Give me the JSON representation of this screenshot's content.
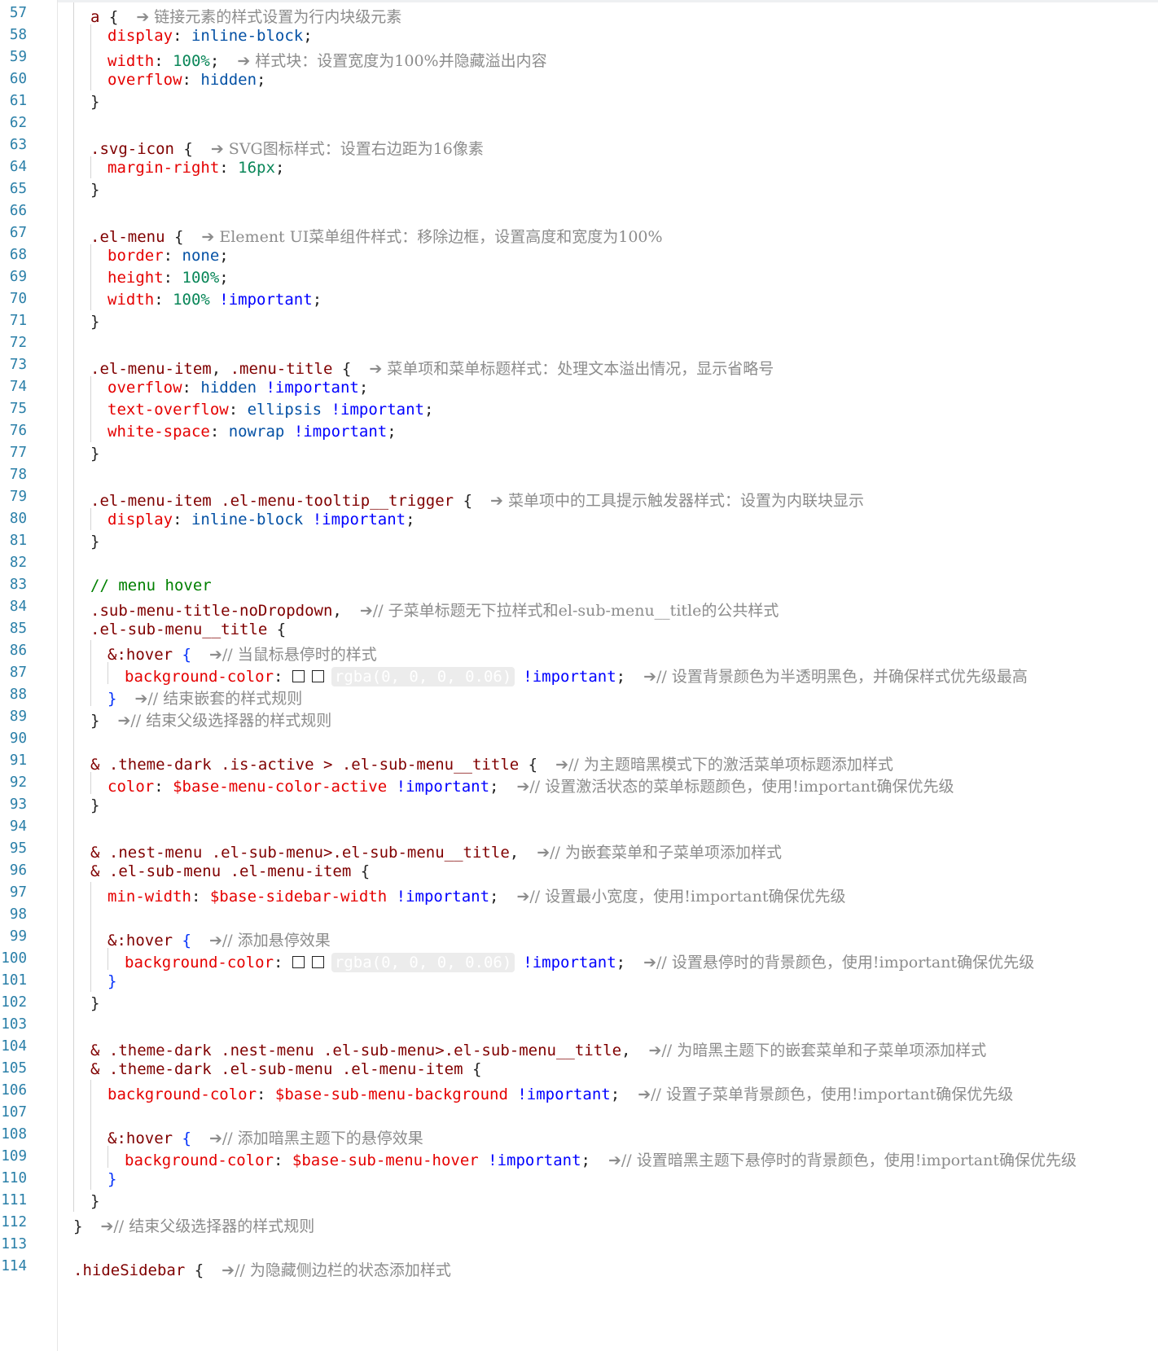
{
  "editor": {
    "lines": [
      {
        "n": "57",
        "indent": 2,
        "tokens": [
          {
            "c": "sel",
            "t": "a "
          },
          {
            "c": "pun",
            "t": "{"
          }
        ],
        "ann": "➔ 链接元素的样式设置为行内块级元素"
      },
      {
        "n": "58",
        "indent": 3,
        "tokens": [
          {
            "c": "prop",
            "t": "display"
          },
          {
            "c": "pun",
            "t": ": "
          },
          {
            "c": "val",
            "t": "inline-block"
          },
          {
            "c": "pun",
            "t": ";"
          }
        ]
      },
      {
        "n": "59",
        "indent": 3,
        "tokens": [
          {
            "c": "prop",
            "t": "width"
          },
          {
            "c": "pun",
            "t": ": "
          },
          {
            "c": "num",
            "t": "100%"
          },
          {
            "c": "pun",
            "t": ";"
          }
        ],
        "ann": "➔ 样式块：设置宽度为100%并隐藏溢出内容"
      },
      {
        "n": "60",
        "indent": 3,
        "tokens": [
          {
            "c": "prop",
            "t": "overflow"
          },
          {
            "c": "pun",
            "t": ": "
          },
          {
            "c": "val",
            "t": "hidden"
          },
          {
            "c": "pun",
            "t": ";"
          }
        ]
      },
      {
        "n": "61",
        "indent": 2,
        "tokens": [
          {
            "c": "pun",
            "t": "}"
          }
        ]
      },
      {
        "n": "62",
        "indent": 0,
        "tokens": []
      },
      {
        "n": "63",
        "indent": 2,
        "tokens": [
          {
            "c": "sel",
            "t": ".svg-icon "
          },
          {
            "c": "pun",
            "t": "{"
          }
        ],
        "ann": "➔ SVG图标样式：设置右边距为16像素"
      },
      {
        "n": "64",
        "indent": 3,
        "tokens": [
          {
            "c": "prop",
            "t": "margin-right"
          },
          {
            "c": "pun",
            "t": ": "
          },
          {
            "c": "num",
            "t": "16px"
          },
          {
            "c": "pun",
            "t": ";"
          }
        ]
      },
      {
        "n": "65",
        "indent": 2,
        "tokens": [
          {
            "c": "pun",
            "t": "}"
          }
        ]
      },
      {
        "n": "66",
        "indent": 0,
        "tokens": []
      },
      {
        "n": "67",
        "indent": 2,
        "tokens": [
          {
            "c": "sel",
            "t": ".el-menu "
          },
          {
            "c": "pun",
            "t": "{"
          }
        ],
        "ann": "➔ Element UI菜单组件样式：移除边框，设置高度和宽度为100%"
      },
      {
        "n": "68",
        "indent": 3,
        "tokens": [
          {
            "c": "prop",
            "t": "border"
          },
          {
            "c": "pun",
            "t": ": "
          },
          {
            "c": "val",
            "t": "none"
          },
          {
            "c": "pun",
            "t": ";"
          }
        ]
      },
      {
        "n": "69",
        "indent": 3,
        "tokens": [
          {
            "c": "prop",
            "t": "height"
          },
          {
            "c": "pun",
            "t": ": "
          },
          {
            "c": "num",
            "t": "100%"
          },
          {
            "c": "pun",
            "t": ";"
          }
        ]
      },
      {
        "n": "70",
        "indent": 3,
        "tokens": [
          {
            "c": "prop",
            "t": "width"
          },
          {
            "c": "pun",
            "t": ": "
          },
          {
            "c": "num",
            "t": "100% "
          },
          {
            "c": "imp",
            "t": "!important"
          },
          {
            "c": "pun",
            "t": ";"
          }
        ]
      },
      {
        "n": "71",
        "indent": 2,
        "tokens": [
          {
            "c": "pun",
            "t": "}"
          }
        ]
      },
      {
        "n": "72",
        "indent": 0,
        "tokens": []
      },
      {
        "n": "73",
        "indent": 2,
        "tokens": [
          {
            "c": "sel",
            "t": ".el-menu-item"
          },
          {
            "c": "pun",
            "t": ", "
          },
          {
            "c": "sel",
            "t": ".menu-title "
          },
          {
            "c": "pun",
            "t": "{"
          }
        ],
        "ann": "➔ 菜单项和菜单标题样式：处理文本溢出情况，显示省略号"
      },
      {
        "n": "74",
        "indent": 3,
        "tokens": [
          {
            "c": "prop",
            "t": "overflow"
          },
          {
            "c": "pun",
            "t": ": "
          },
          {
            "c": "val",
            "t": "hidden "
          },
          {
            "c": "imp",
            "t": "!important"
          },
          {
            "c": "pun",
            "t": ";"
          }
        ]
      },
      {
        "n": "75",
        "indent": 3,
        "tokens": [
          {
            "c": "prop",
            "t": "text-overflow"
          },
          {
            "c": "pun",
            "t": ": "
          },
          {
            "c": "val",
            "t": "ellipsis "
          },
          {
            "c": "imp",
            "t": "!important"
          },
          {
            "c": "pun",
            "t": ";"
          }
        ]
      },
      {
        "n": "76",
        "indent": 3,
        "tokens": [
          {
            "c": "prop",
            "t": "white-space"
          },
          {
            "c": "pun",
            "t": ": "
          },
          {
            "c": "val",
            "t": "nowrap "
          },
          {
            "c": "imp",
            "t": "!important"
          },
          {
            "c": "pun",
            "t": ";"
          }
        ]
      },
      {
        "n": "77",
        "indent": 2,
        "tokens": [
          {
            "c": "pun",
            "t": "}"
          }
        ]
      },
      {
        "n": "78",
        "indent": 0,
        "tokens": []
      },
      {
        "n": "79",
        "indent": 2,
        "tokens": [
          {
            "c": "sel",
            "t": ".el-menu-item .el-menu-tooltip__trigger "
          },
          {
            "c": "pun",
            "t": "{"
          }
        ],
        "ann": "➔ 菜单项中的工具提示触发器样式：设置为内联块显示"
      },
      {
        "n": "80",
        "indent": 3,
        "tokens": [
          {
            "c": "prop",
            "t": "display"
          },
          {
            "c": "pun",
            "t": ": "
          },
          {
            "c": "val",
            "t": "inline-block "
          },
          {
            "c": "imp",
            "t": "!important"
          },
          {
            "c": "pun",
            "t": ";"
          }
        ]
      },
      {
        "n": "81",
        "indent": 2,
        "tokens": [
          {
            "c": "pun",
            "t": "}"
          }
        ]
      },
      {
        "n": "82",
        "indent": 0,
        "tokens": []
      },
      {
        "n": "83",
        "indent": 2,
        "tokens": [
          {
            "c": "ccom",
            "t": "// menu hover"
          }
        ]
      },
      {
        "n": "84",
        "indent": 2,
        "tokens": [
          {
            "c": "sel",
            "t": ".sub-menu-title-noDropdown"
          },
          {
            "c": "pun",
            "t": ","
          }
        ],
        "ann": "➔// 子菜单标题无下拉样式和el-sub-menu__title的公共样式"
      },
      {
        "n": "85",
        "indent": 2,
        "tokens": [
          {
            "c": "sel",
            "t": ".el-sub-menu__title "
          },
          {
            "c": "pun",
            "t": "{"
          }
        ]
      },
      {
        "n": "86",
        "indent": 3,
        "tokens": [
          {
            "c": "sel",
            "t": "&:hover "
          },
          {
            "c": "brb",
            "t": "{"
          }
        ],
        "ann": "➔// 当鼠标悬停时的样式"
      },
      {
        "n": "87",
        "indent": 4,
        "tokens": [
          {
            "c": "prop",
            "t": "background-color"
          },
          {
            "c": "pun",
            "t": ": "
          },
          {
            "c": "swatch",
            "t": ""
          },
          {
            "c": "swatch",
            "t": ""
          },
          {
            "c": "chip",
            "t": "rgba(0, 0, 0, 0.06)"
          },
          {
            "c": "imp",
            "t": "!important"
          },
          {
            "c": "pun",
            "t": ";"
          }
        ],
        "ann": "➔// 设置背景颜色为半透明黑色，并确保样式优先级最高"
      },
      {
        "n": "88",
        "indent": 3,
        "tokens": [
          {
            "c": "brb",
            "t": "}"
          }
        ],
        "ann": "➔// 结束嵌套的样式规则"
      },
      {
        "n": "89",
        "indent": 2,
        "tokens": [
          {
            "c": "pun",
            "t": "}"
          }
        ],
        "ann": "➔// 结束父级选择器的样式规则"
      },
      {
        "n": "90",
        "indent": 0,
        "tokens": []
      },
      {
        "n": "91",
        "indent": 2,
        "tokens": [
          {
            "c": "sel",
            "t": "& .theme-dark .is-active > .el-sub-menu__title "
          },
          {
            "c": "pun",
            "t": "{"
          }
        ],
        "ann": "➔// 为主题暗黑模式下的激活菜单项标题添加样式"
      },
      {
        "n": "92",
        "indent": 3,
        "tokens": [
          {
            "c": "prop",
            "t": "color"
          },
          {
            "c": "pun",
            "t": ": "
          },
          {
            "c": "var",
            "t": "$base-menu-color-active "
          },
          {
            "c": "imp",
            "t": "!important"
          },
          {
            "c": "pun",
            "t": ";"
          }
        ],
        "ann": "➔// 设置激活状态的菜单标题颜色，使用!important确保优先级"
      },
      {
        "n": "93",
        "indent": 2,
        "tokens": [
          {
            "c": "pun",
            "t": "}"
          }
        ]
      },
      {
        "n": "94",
        "indent": 0,
        "tokens": []
      },
      {
        "n": "95",
        "indent": 2,
        "tokens": [
          {
            "c": "sel",
            "t": "& .nest-menu .el-sub-menu>.el-sub-menu__title"
          },
          {
            "c": "pun",
            "t": ","
          }
        ],
        "ann": "➔// 为嵌套菜单和子菜单项添加样式"
      },
      {
        "n": "96",
        "indent": 2,
        "tokens": [
          {
            "c": "sel",
            "t": "& .el-sub-menu .el-menu-item "
          },
          {
            "c": "pun",
            "t": "{"
          }
        ]
      },
      {
        "n": "97",
        "indent": 3,
        "tokens": [
          {
            "c": "prop",
            "t": "min-width"
          },
          {
            "c": "pun",
            "t": ": "
          },
          {
            "c": "var",
            "t": "$base-sidebar-width "
          },
          {
            "c": "imp",
            "t": "!important"
          },
          {
            "c": "pun",
            "t": ";"
          }
        ],
        "ann": "➔// 设置最小宽度，使用!important确保优先级"
      },
      {
        "n": "98",
        "indent": 0,
        "tokens": []
      },
      {
        "n": "99",
        "indent": 3,
        "tokens": [
          {
            "c": "sel",
            "t": "&:hover "
          },
          {
            "c": "brb",
            "t": "{"
          }
        ],
        "ann": "➔// 添加悬停效果"
      },
      {
        "n": "100",
        "indent": 4,
        "tokens": [
          {
            "c": "prop",
            "t": "background-color"
          },
          {
            "c": "pun",
            "t": ": "
          },
          {
            "c": "swatch",
            "t": ""
          },
          {
            "c": "swatch",
            "t": ""
          },
          {
            "c": "chip",
            "t": "rgba(0, 0, 0, 0.06)"
          },
          {
            "c": "imp",
            "t": "!important"
          },
          {
            "c": "pun",
            "t": ";"
          }
        ],
        "ann": "➔// 设置悬停时的背景颜色，使用!important确保优先级"
      },
      {
        "n": "101",
        "indent": 3,
        "tokens": [
          {
            "c": "brb",
            "t": "}"
          }
        ]
      },
      {
        "n": "102",
        "indent": 2,
        "tokens": [
          {
            "c": "pun",
            "t": "}"
          }
        ]
      },
      {
        "n": "103",
        "indent": 0,
        "tokens": []
      },
      {
        "n": "104",
        "indent": 2,
        "tokens": [
          {
            "c": "sel",
            "t": "& .theme-dark .nest-menu .el-sub-menu>.el-sub-menu__title"
          },
          {
            "c": "pun",
            "t": ","
          }
        ],
        "ann": "➔// 为暗黑主题下的嵌套菜单和子菜单项添加样式"
      },
      {
        "n": "105",
        "indent": 2,
        "tokens": [
          {
            "c": "sel",
            "t": "& .theme-dark .el-sub-menu .el-menu-item "
          },
          {
            "c": "pun",
            "t": "{"
          }
        ]
      },
      {
        "n": "106",
        "indent": 3,
        "tokens": [
          {
            "c": "prop",
            "t": "background-color"
          },
          {
            "c": "pun",
            "t": ": "
          },
          {
            "c": "var",
            "t": "$base-sub-menu-background "
          },
          {
            "c": "imp",
            "t": "!important"
          },
          {
            "c": "pun",
            "t": ";"
          }
        ],
        "ann": "➔// 设置子菜单背景颜色，使用!important确保优先级"
      },
      {
        "n": "107",
        "indent": 0,
        "tokens": []
      },
      {
        "n": "108",
        "indent": 3,
        "tokens": [
          {
            "c": "sel",
            "t": "&:hover "
          },
          {
            "c": "brb",
            "t": "{"
          }
        ],
        "ann": "➔// 添加暗黑主题下的悬停效果"
      },
      {
        "n": "109",
        "indent": 4,
        "tokens": [
          {
            "c": "prop",
            "t": "background-color"
          },
          {
            "c": "pun",
            "t": ": "
          },
          {
            "c": "var",
            "t": "$base-sub-menu-hover "
          },
          {
            "c": "imp",
            "t": "!important"
          },
          {
            "c": "pun",
            "t": ";"
          }
        ],
        "ann": "➔// 设置暗黑主题下悬停时的背景颜色，使用!important确保优先级"
      },
      {
        "n": "110",
        "indent": 3,
        "tokens": [
          {
            "c": "brb",
            "t": "}"
          }
        ]
      },
      {
        "n": "111",
        "indent": 2,
        "tokens": [
          {
            "c": "pun",
            "t": "}"
          }
        ]
      },
      {
        "n": "112",
        "indent": 1,
        "tokens": [
          {
            "c": "pun",
            "t": "}"
          }
        ],
        "ann": "➔// 结束父级选择器的样式规则"
      },
      {
        "n": "113",
        "indent": 0,
        "tokens": []
      },
      {
        "n": "114",
        "indent": 1,
        "tokens": [
          {
            "c": "sel",
            "t": ".hideSidebar "
          },
          {
            "c": "pun",
            "t": "{"
          }
        ],
        "ann": "➔// 为隐藏侧边栏的状态添加样式"
      }
    ]
  }
}
